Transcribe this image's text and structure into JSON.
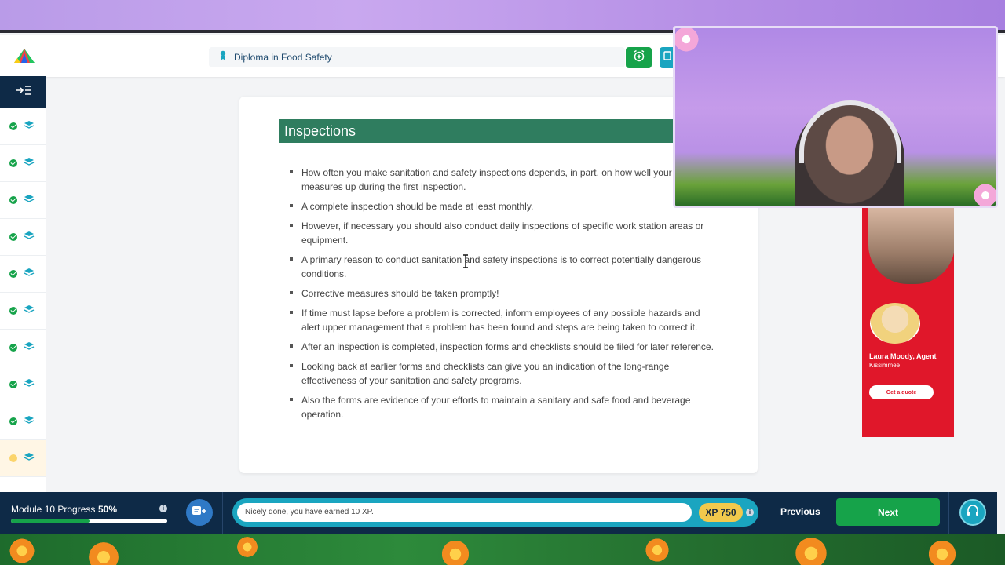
{
  "header": {
    "course_title": "Diploma in Food Safety",
    "icons": [
      "logo-icon",
      "graduation-icon",
      "alarm-add-icon",
      "book-icon"
    ]
  },
  "sidebar": {
    "toggle_icon": "expand-menu-icon",
    "items": [
      {
        "status": "completed",
        "icon": "layers-icon"
      },
      {
        "status": "completed",
        "icon": "layers-icon"
      },
      {
        "status": "completed",
        "icon": "layers-icon"
      },
      {
        "status": "completed",
        "icon": "layers-icon"
      },
      {
        "status": "completed",
        "icon": "layers-icon"
      },
      {
        "status": "completed",
        "icon": "layers-icon"
      },
      {
        "status": "completed",
        "icon": "layers-icon"
      },
      {
        "status": "completed",
        "icon": "layers-icon"
      },
      {
        "status": "completed",
        "icon": "layers-icon"
      },
      {
        "status": "current",
        "icon": "layers-icon"
      }
    ]
  },
  "lesson": {
    "title": "Inspections",
    "bullets": [
      "How often you make sanitation and safety inspections depends, in part, on how well your pr… measures up during the first inspection.",
      "A complete inspection should be made at least monthly.",
      "However, if necessary you should also conduct daily inspections of specific work station areas or equipment.",
      "A primary reason to conduct sanitation and safety inspections is to correct potentially dangerous conditions.",
      "Corrective measures should be taken promptly!",
      "If time must lapse before a problem is corrected, inform employees of any possible hazards and alert upper management that a problem has been found and steps are being taken to correct it.",
      "After an inspection is completed, inspection forms and checklists should be filed for later reference.",
      "Looking back at earlier forms and checklists can give you an indication of the long-range effectiveness of your sanitation and safety programs.",
      "Also the forms are evidence of your efforts to maintain a sanitary and safe food and beverage operation."
    ]
  },
  "ad": {
    "agent_name": "Laura Moody, Agent",
    "location": "Kissimmee",
    "cta": "Get a quote"
  },
  "footer": {
    "progress_label": "Module 10 Progress",
    "progress_text": "50%",
    "progress_value": 0.5,
    "message": "Nicely done, you have earned 10 XP.",
    "xp": "XP 750",
    "previous": "Previous",
    "next": "Next"
  },
  "colors": {
    "navy": "#0e2a47",
    "green": "#16a34a",
    "teal_header": "#2f7d5f",
    "xp_gold": "#f2c94c",
    "ad_red": "#e0172a"
  }
}
